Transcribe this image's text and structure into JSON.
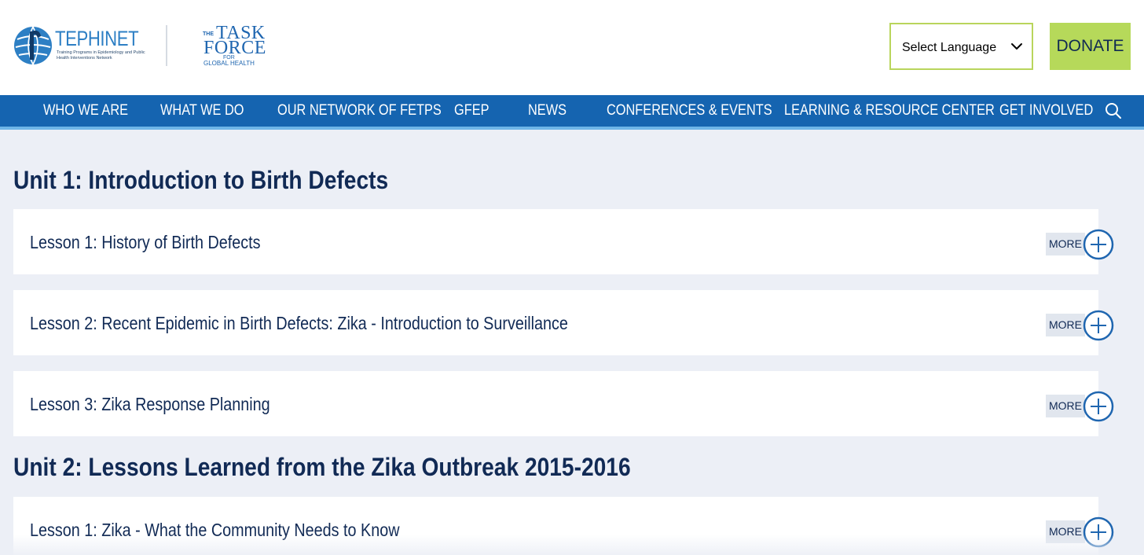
{
  "header": {
    "tephinet_name": "TEPHINET",
    "tephinet_tagline": "Training Programs in Epidemiology and Public Health Interventions Network",
    "taskforce": {
      "the": "THE",
      "task": "TASK",
      "force": "FORCE",
      "for": "FOR",
      "global": "GLOBAL HEALTH"
    },
    "language_select": {
      "label": "Select Language"
    },
    "donate_label": "DONATE"
  },
  "nav": {
    "items": [
      "WHO WE ARE",
      "WHAT WE DO",
      "OUR NETWORK OF FETPS",
      "GFEP",
      "NEWS",
      "CONFERENCES & EVENTS",
      "LEARNING & RESOURCE CENTER",
      "GET INVOLVED"
    ]
  },
  "units": [
    {
      "title": "Unit 1: Introduction to Birth Defects",
      "lessons": [
        {
          "title": "Lesson 1: History of Birth Defects",
          "more": "MORE"
        },
        {
          "title": "Lesson 2: Recent Epidemic in Birth Defects: Zika - Introduction to Surveillance",
          "more": "MORE"
        },
        {
          "title": "Lesson 3: Zika Response Planning",
          "more": "MORE"
        }
      ]
    },
    {
      "title": "Unit 2: Lessons Learned from the Zika Outbreak 2015-2016",
      "lessons": [
        {
          "title": "Lesson 1: Zika - What the Community Needs to Know",
          "more": "MORE"
        }
      ]
    }
  ],
  "colors": {
    "nav_bg": "#1564b0",
    "nav_accent": "#6eb5e8",
    "donate_bg": "#b6d95a",
    "page_bg": "#eceff6",
    "heading_text": "#112a55"
  }
}
